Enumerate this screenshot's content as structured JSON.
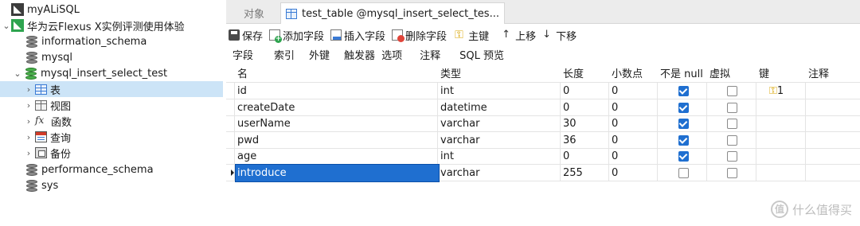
{
  "tree": {
    "connection": "myALiSQL",
    "server": "华为云Flexus X实例评测使用体验",
    "databases": [
      "information_schema",
      "mysql",
      "mysql_insert_select_test",
      "performance_schema",
      "sys"
    ],
    "children": [
      "表",
      "视图",
      "函数",
      "查询",
      "备份"
    ]
  },
  "tabs": {
    "objects": "对象",
    "active": "test_table @mysql_insert_select_tes..."
  },
  "toolbar": {
    "save": "保存",
    "add_field": "添加字段",
    "insert_field": "插入字段",
    "delete_field": "删除字段",
    "primary_key": "主键",
    "move_up": "上移",
    "move_down": "下移"
  },
  "subtabs": [
    "字段",
    "索引",
    "外键",
    "触发器",
    "选项",
    "注释",
    "SQL 预览"
  ],
  "grid": {
    "headers": [
      "名",
      "类型",
      "长度",
      "小数点",
      "不是 null",
      "虚拟",
      "键",
      "注释"
    ],
    "rows": [
      {
        "name": "id",
        "type": "int",
        "length": "0",
        "decimals": "0",
        "not_null": true,
        "virtual": false,
        "key": "1"
      },
      {
        "name": "createDate",
        "type": "datetime",
        "length": "0",
        "decimals": "0",
        "not_null": true,
        "virtual": false,
        "key": ""
      },
      {
        "name": "userName",
        "type": "varchar",
        "length": "30",
        "decimals": "0",
        "not_null": true,
        "virtual": false,
        "key": ""
      },
      {
        "name": "pwd",
        "type": "varchar",
        "length": "36",
        "decimals": "0",
        "not_null": true,
        "virtual": false,
        "key": ""
      },
      {
        "name": "age",
        "type": "int",
        "length": "0",
        "decimals": "0",
        "not_null": true,
        "virtual": false,
        "key": ""
      },
      {
        "name": "introduce",
        "type": "varchar",
        "length": "255",
        "decimals": "0",
        "not_null": false,
        "virtual": false,
        "key": ""
      }
    ]
  },
  "watermark": {
    "logo": "值",
    "text": "什么值得买"
  },
  "colors": {
    "accent": "#1f6fd0",
    "selection": "#cce4f7",
    "db_green": "#48b04a",
    "key_gold": "#d9a400"
  }
}
